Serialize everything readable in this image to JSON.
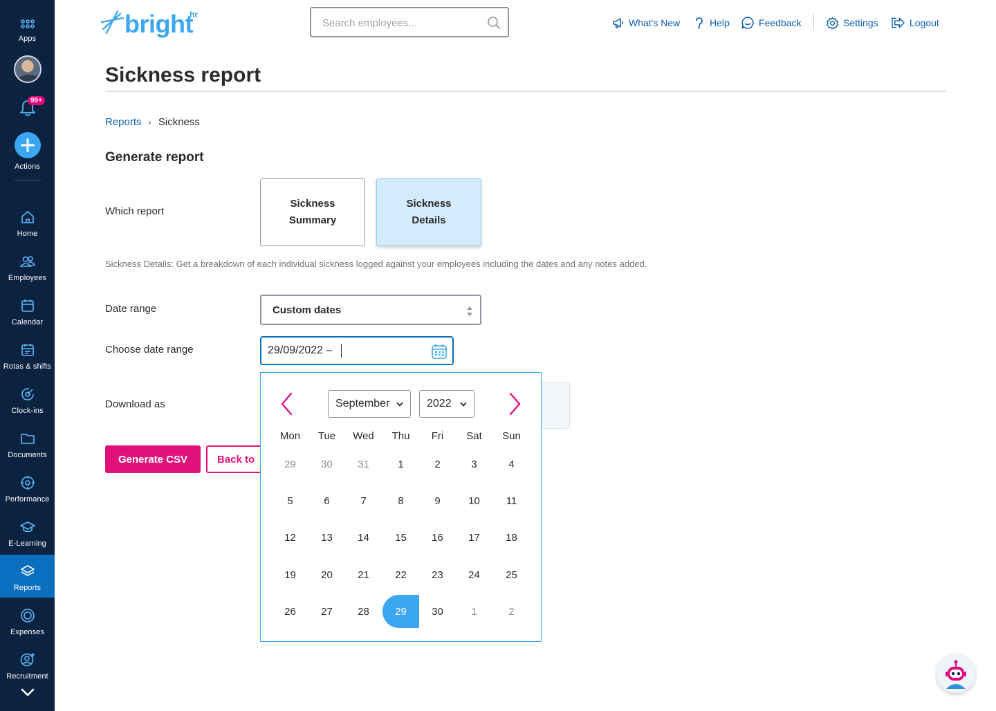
{
  "sidebar": {
    "apps_label": "Apps",
    "notification_badge": "99+",
    "actions_label": "Actions",
    "items": [
      {
        "label": "Home",
        "icon": "home-icon"
      },
      {
        "label": "Employees",
        "icon": "employees-icon"
      },
      {
        "label": "Calendar",
        "icon": "calendar-icon"
      },
      {
        "label": "Rotas & shifts",
        "icon": "rotas-icon"
      },
      {
        "label": "Clock-ins",
        "icon": "clock-in-icon"
      },
      {
        "label": "Documents",
        "icon": "folder-icon"
      },
      {
        "label": "Performance",
        "icon": "target-icon"
      },
      {
        "label": "E-Learning",
        "icon": "graduation-cap-icon"
      },
      {
        "label": "Reports",
        "icon": "layers-icon",
        "active": true
      },
      {
        "label": "Expenses",
        "icon": "expenses-icon"
      },
      {
        "label": "Recruitment",
        "icon": "recruitment-icon"
      }
    ]
  },
  "brand": {
    "name": "bright",
    "suffix": "hr",
    "color": "#3ba6f2"
  },
  "search": {
    "placeholder": "Search employees..."
  },
  "topnav": {
    "whats_new": "What's New",
    "help": "Help",
    "feedback": "Feedback",
    "settings": "Settings",
    "logout": "Logout"
  },
  "page": {
    "title": "Sickness report",
    "breadcrumb": {
      "parent": "Reports",
      "current": "Sickness"
    },
    "section_title": "Generate report",
    "which_report_label": "Which report",
    "report_options": [
      {
        "line1": "Sickness",
        "line2": "Summary",
        "selected": false
      },
      {
        "line1": "Sickness",
        "line2": "Details",
        "selected": true
      }
    ],
    "description": "Sickness Details: Get a breakdown of each individual sickness logged against your employees including the dates and any notes added.",
    "date_range_label": "Date range",
    "date_range_value": "Custom dates",
    "choose_range_label": "Choose date range",
    "choose_range_value": "29/09/2022 –",
    "download_label": "Download as",
    "generate_button": "Generate CSV",
    "back_button": "Back to"
  },
  "calendar": {
    "month": "September",
    "year": "2022",
    "weekdays": [
      "Mon",
      "Tue",
      "Wed",
      "Thu",
      "Fri",
      "Sat",
      "Sun"
    ],
    "weeks": [
      [
        {
          "d": "29",
          "m": true
        },
        {
          "d": "30",
          "m": true
        },
        {
          "d": "31",
          "m": true
        },
        {
          "d": "1"
        },
        {
          "d": "2"
        },
        {
          "d": "3"
        },
        {
          "d": "4"
        }
      ],
      [
        {
          "d": "5"
        },
        {
          "d": "6"
        },
        {
          "d": "7"
        },
        {
          "d": "8"
        },
        {
          "d": "9"
        },
        {
          "d": "10"
        },
        {
          "d": "11"
        }
      ],
      [
        {
          "d": "12"
        },
        {
          "d": "13"
        },
        {
          "d": "14"
        },
        {
          "d": "15"
        },
        {
          "d": "16"
        },
        {
          "d": "17"
        },
        {
          "d": "18"
        }
      ],
      [
        {
          "d": "19"
        },
        {
          "d": "20"
        },
        {
          "d": "21"
        },
        {
          "d": "22"
        },
        {
          "d": "23"
        },
        {
          "d": "24"
        },
        {
          "d": "25"
        }
      ],
      [
        {
          "d": "26"
        },
        {
          "d": "27"
        },
        {
          "d": "28"
        },
        {
          "d": "29",
          "s": true
        },
        {
          "d": "30"
        },
        {
          "d": "1",
          "m": true
        },
        {
          "d": "2",
          "m": true
        }
      ]
    ]
  },
  "colors": {
    "sidebar": "#0b2240",
    "accent": "#3ba6f2",
    "link": "#0b5fae",
    "primary_button": "#e0117a",
    "selected_card": "#d3ebfb"
  }
}
